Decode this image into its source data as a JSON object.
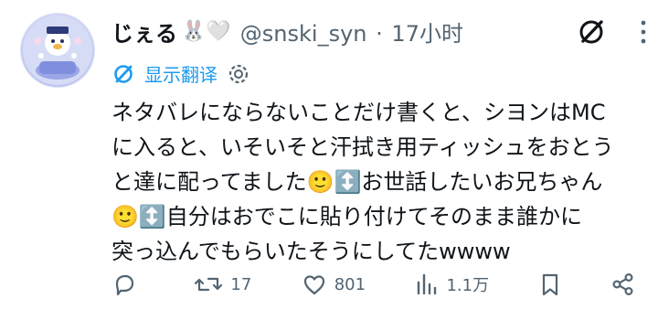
{
  "tweet": {
    "display_name": "じぇる",
    "name_emojis": "🐰🤍",
    "handle": "@snski_syn",
    "separator": "·",
    "time": "17小时",
    "translate_label": "显示翻译",
    "body_lines": [
      "ネタバレにならないことだけ書くと、シヨンはMC",
      "に入ると、いそいそと汗拭き用ティッシュをおとう",
      "と達に配ってました🙂↕️お世話したいお兄ちゃん",
      "🙂↕️自分はおでこに貼り付けてそのまま誰かに",
      "突っ込んでもらいたそうにしてたwwww"
    ]
  },
  "actions": {
    "replies": "",
    "retweets": "17",
    "likes": "801",
    "views": "1.1万"
  },
  "colors": {
    "link": "#1d9bf0",
    "muted": "#536471",
    "text": "#0f1419"
  },
  "icons": [
    "avatar-image",
    "grok-icon",
    "more-icon",
    "translate-icon",
    "settings-icon",
    "reply-icon",
    "retweet-icon",
    "like-icon",
    "views-icon",
    "bookmark-icon",
    "share-icon"
  ]
}
